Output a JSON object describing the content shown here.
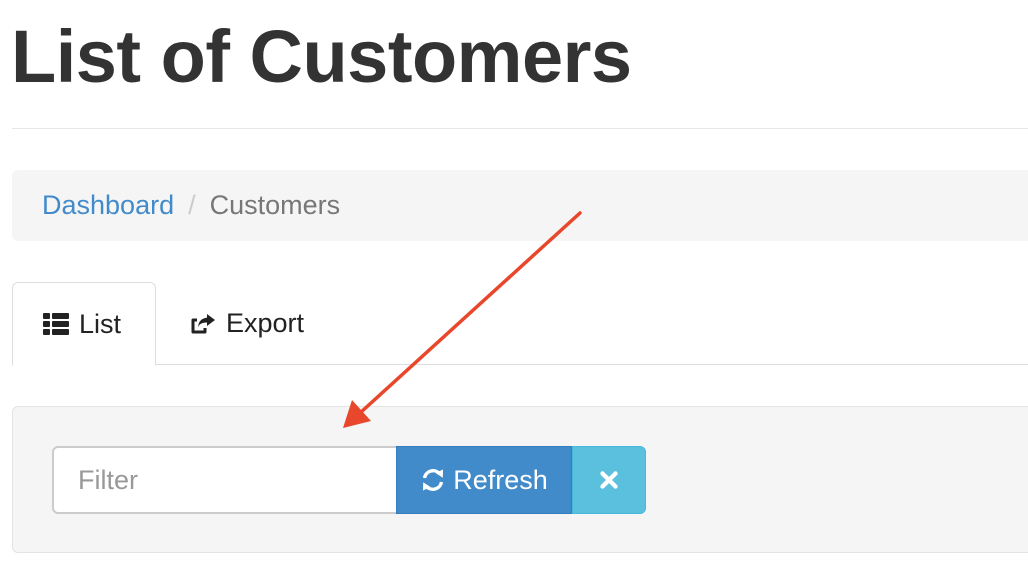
{
  "header": {
    "title": "List of Customers"
  },
  "breadcrumb": {
    "items": [
      {
        "label": "Dashboard",
        "link": true
      },
      {
        "label": "Customers",
        "link": false
      }
    ],
    "separator": "/"
  },
  "tabs": [
    {
      "label": "List",
      "icon": "list-icon",
      "active": true
    },
    {
      "label": "Export",
      "icon": "share-square-icon",
      "active": false
    }
  ],
  "filter": {
    "placeholder": "Filter",
    "value": "",
    "refresh_label": "Refresh",
    "refresh_icon": "refresh-icon",
    "clear_icon": "times-icon"
  },
  "annotation": {
    "icon": "arrow-annotation",
    "color": "#e8472b"
  },
  "colors": {
    "primary": "#428bca",
    "info": "#5bc0de",
    "link": "#428bca",
    "text": "#333333",
    "panel_bg": "#f5f5f5"
  }
}
